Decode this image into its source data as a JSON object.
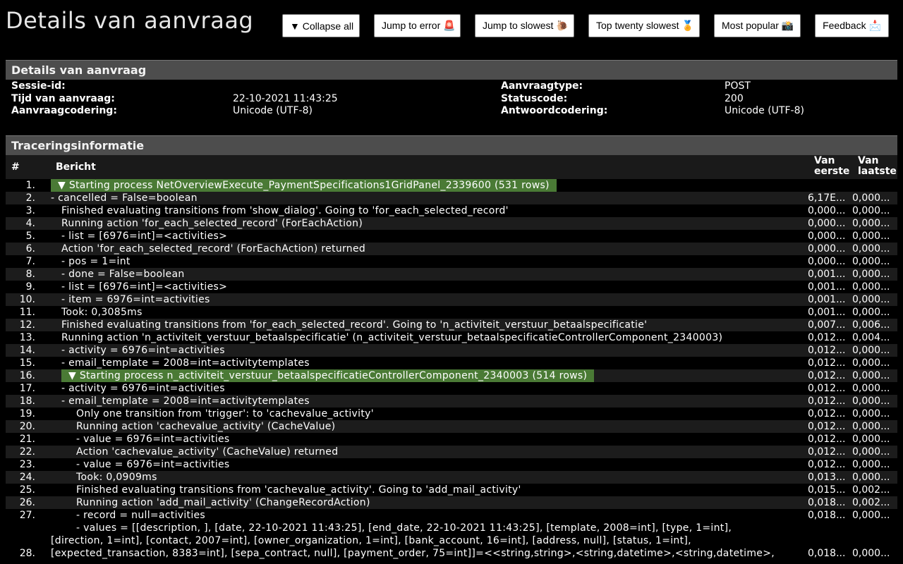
{
  "page": {
    "title": "Details van aanvraag"
  },
  "buttons": {
    "collapse_all": "▼ Collapse all",
    "jump_error": "Jump to error 🚨",
    "jump_slowest": "Jump to slowest 🐌",
    "top_twenty": "Top twenty slowest 🏅",
    "most_popular": "Most popular 📸",
    "feedback": "Feedback 📩"
  },
  "request": {
    "header": "Details van aanvraag",
    "session_label": "Sessie-id:",
    "session_value": "",
    "time_label": "Tijd van aanvraag:",
    "time_value": "22-10-2021 11:43:25",
    "encoding_label": "Aanvraagcodering:",
    "encoding_value": "Unicode (UTF-8)",
    "type_label": "Aanvraagtype:",
    "type_value": "POST",
    "status_label": "Statuscode:",
    "status_value": "200",
    "response_encoding_label": "Antwoordcodering:",
    "response_encoding_value": "Unicode (UTF-8)"
  },
  "trace": {
    "header": "Traceringsinformatie",
    "col_num": "#",
    "col_msg": "Bericht",
    "col_first": "Van eerste",
    "col_last": "Van laatste",
    "rows": [
      {
        "n": "1.",
        "msg": "▼ Starting process NetOverviewExecute_PaymentSpecifications1GridPanel_2339600 (531 rows)",
        "first": "",
        "last": "",
        "indent": 0,
        "hl": true
      },
      {
        "n": "2.",
        "msg": "- cancelled = False=boolean",
        "first": "6,17E...",
        "last": "0,000...",
        "indent": 0
      },
      {
        "n": "3.",
        "msg": "Finished evaluating transitions from 'show_dialog'. Going to 'for_each_selected_record'",
        "first": "0,000...",
        "last": "0,000...",
        "indent": 1
      },
      {
        "n": "4.",
        "msg": "Running action 'for_each_selected_record' (ForEachAction)",
        "first": "0,000...",
        "last": "0,000...",
        "indent": 1
      },
      {
        "n": "5.",
        "msg": "- list = [6976=int]=<activities>",
        "first": "0,000...",
        "last": "0,000...",
        "indent": 1
      },
      {
        "n": "6.",
        "msg": "Action 'for_each_selected_record' (ForEachAction) returned",
        "first": "0,000...",
        "last": "0,000...",
        "indent": 1
      },
      {
        "n": "7.",
        "msg": "- pos = 1=int",
        "first": "0,000...",
        "last": "0,000...",
        "indent": 1
      },
      {
        "n": "8.",
        "msg": "- done = False=boolean",
        "first": "0,001...",
        "last": "0,000...",
        "indent": 1
      },
      {
        "n": "9.",
        "msg": "- list = [6976=int]=<activities>",
        "first": "0,001...",
        "last": "0,000...",
        "indent": 1
      },
      {
        "n": "10.",
        "msg": "- item = 6976=int=activities",
        "first": "0,001...",
        "last": "0,000...",
        "indent": 1
      },
      {
        "n": "11.",
        "msg": "Took: 0,3085ms",
        "first": "0,001...",
        "last": "0,000...",
        "indent": 1
      },
      {
        "n": "12.",
        "msg": "Finished evaluating transitions from 'for_each_selected_record'. Going to 'n_activiteit_verstuur_betaalspecificatie'",
        "first": "0,007...",
        "last": "0,006...",
        "indent": 1
      },
      {
        "n": "13.",
        "msg": "Running action 'n_activiteit_verstuur_betaalspecificatie' (n_activiteit_verstuur_betaalspecificatieControllerComponent_2340003)",
        "first": "0,012...",
        "last": "0,004...",
        "indent": 1
      },
      {
        "n": "14.",
        "msg": "- activity = 6976=int=activities",
        "first": "0,012...",
        "last": "0,000...",
        "indent": 1
      },
      {
        "n": "15.",
        "msg": "- email_template = 2008=int=activitytemplates",
        "first": "0,012...",
        "last": "0,000...",
        "indent": 1
      },
      {
        "n": "16.",
        "msg": "▼ Starting process n_activiteit_verstuur_betaalspecificatieControllerComponent_2340003 (514 rows)",
        "first": "0,012...",
        "last": "0,000...",
        "indent": 1,
        "hl": true
      },
      {
        "n": "17.",
        "msg": "- activity = 6976=int=activities",
        "first": "0,012...",
        "last": "0,000...",
        "indent": 1
      },
      {
        "n": "18.",
        "msg": "- email_template = 2008=int=activitytemplates",
        "first": "0,012...",
        "last": "0,000...",
        "indent": 1
      },
      {
        "n": "19.",
        "msg": "Only one transition from 'trigger': to 'cachevalue_activity'",
        "first": "0,012...",
        "last": "0,000...",
        "indent": 2
      },
      {
        "n": "20.",
        "msg": "Running action 'cachevalue_activity' (CacheValue)",
        "first": "0,012...",
        "last": "0,000...",
        "indent": 2
      },
      {
        "n": "21.",
        "msg": "- value = 6976=int=activities",
        "first": "0,012...",
        "last": "0,000...",
        "indent": 2
      },
      {
        "n": "22.",
        "msg": "Action 'cachevalue_activity' (CacheValue) returned",
        "first": "0,012...",
        "last": "0,000...",
        "indent": 2
      },
      {
        "n": "23.",
        "msg": "- value = 6976=int=activities",
        "first": "0,012...",
        "last": "0,000...",
        "indent": 2
      },
      {
        "n": "24.",
        "msg": "Took: 0,0909ms",
        "first": "0,013...",
        "last": "0,000...",
        "indent": 2
      },
      {
        "n": "25.",
        "msg": "Finished evaluating transitions from 'cachevalue_activity'. Going to 'add_mail_activity'",
        "first": "0,015...",
        "last": "0,002...",
        "indent": 2
      },
      {
        "n": "26.",
        "msg": "Running action 'add_mail_activity' (ChangeRecordAction)",
        "first": "0,018...",
        "last": "0,002...",
        "indent": 2
      },
      {
        "n": "27.",
        "msg": "- record = null=activities",
        "first": "0,018...",
        "last": "0,000...",
        "indent": 2
      }
    ],
    "big_row": {
      "n": "28.",
      "line1": "- values = [[description, ], [date, 22-10-2021 11:43:25], [end_date, 22-10-2021 11:43:25], [template, 2008=int], [type, 1=int],",
      "line2": "[direction, 1=int], [contact, 2007=int], [owner_organization, 1=int], [bank_account, 16=int], [address, null], [status, 1=int],",
      "line3": "[expected_transaction, 8383=int], [sepa_contract, null], [payment_order, 75=int]]=<<string,string>,<string,datetime>,<string,datetime>,",
      "first": "0,018...",
      "last": "0,000..."
    }
  }
}
